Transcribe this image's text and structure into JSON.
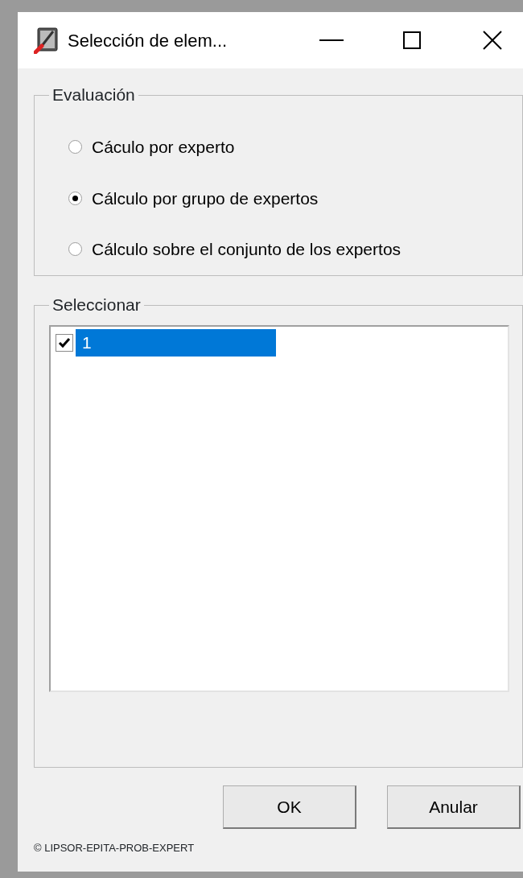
{
  "window": {
    "title": "Selección de elem..."
  },
  "evaluation": {
    "title": "Evaluación",
    "options": [
      {
        "label": "Cáculo por experto",
        "selected": false
      },
      {
        "label": "Cálculo por grupo de expertos",
        "selected": true
      },
      {
        "label": "Cálculo sobre el conjunto de los expertos",
        "selected": false
      }
    ]
  },
  "select": {
    "title": "Seleccionar",
    "items": [
      {
        "label": "1",
        "checked": true,
        "selected": true
      }
    ]
  },
  "buttons": [
    "OK",
    "Anular"
  ],
  "footer": "© LIPSOR-EPITA-PROB-EXPERT"
}
